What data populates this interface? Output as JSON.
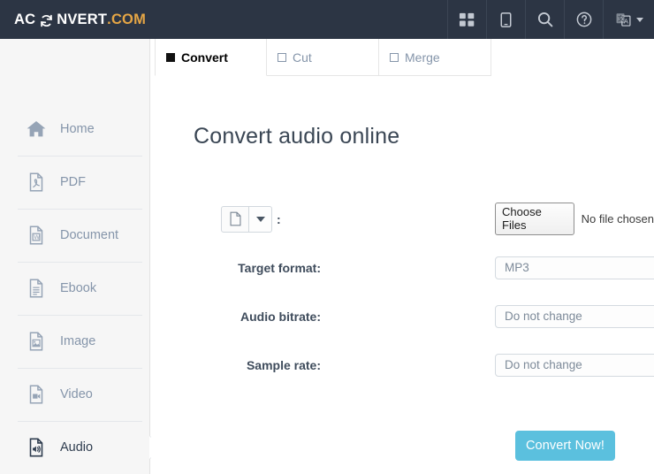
{
  "header": {
    "logo": {
      "part1": "AC",
      "part2": "NVERT",
      "part3": ".COM",
      "mark_icon": "refresh-cycle-icon"
    },
    "nav": [
      {
        "name": "apps-grid-icon",
        "label": ""
      },
      {
        "name": "device-tablet-icon",
        "label": ""
      },
      {
        "name": "search-icon",
        "label": ""
      },
      {
        "name": "help-circle-icon",
        "label": ""
      },
      {
        "name": "language-translate-icon",
        "label": ""
      }
    ]
  },
  "sidebar": {
    "items": [
      {
        "label": "Home",
        "icon": "home-icon",
        "active": false
      },
      {
        "label": "PDF",
        "icon": "pdf-file-icon",
        "active": false
      },
      {
        "label": "Document",
        "icon": "word-document-icon",
        "active": false
      },
      {
        "label": "Ebook",
        "icon": "ebook-file-icon",
        "active": false
      },
      {
        "label": "Image",
        "icon": "image-file-icon",
        "active": false
      },
      {
        "label": "Video",
        "icon": "video-file-icon",
        "active": false
      },
      {
        "label": "Audio",
        "icon": "audio-file-icon",
        "active": true
      }
    ]
  },
  "main": {
    "tabs": [
      {
        "label": "Convert",
        "active": true
      },
      {
        "label": "Cut",
        "active": false
      },
      {
        "label": "Merge",
        "active": false
      }
    ],
    "page_title": "Convert audio online",
    "file_row": {
      "filetype_icon": "document-page-icon",
      "dropdown_icon": "caret-down-icon",
      "separator": ":",
      "choose_files_label": "Choose Files",
      "no_file_text": "No file chosen"
    },
    "fields": [
      {
        "label": "Target format:",
        "value": "MP3"
      },
      {
        "label": "Audio bitrate:",
        "value": "Do not change"
      },
      {
        "label": "Sample rate:",
        "value": "Do not change"
      }
    ],
    "submit_label": "Convert Now!"
  },
  "colors": {
    "header_bg": "#2c3544",
    "logo_accent": "#e4a545",
    "sidebar_bg": "#f6f6f6",
    "button_primary": "#5bc0de",
    "text_muted": "#8595aa",
    "text_dark": "#3a4654"
  }
}
